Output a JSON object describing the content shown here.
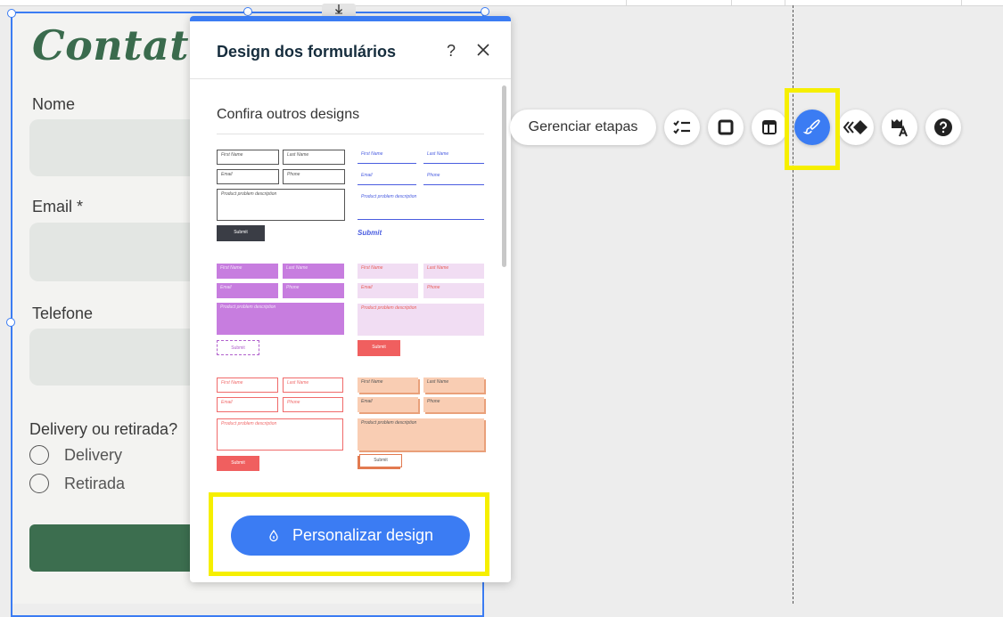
{
  "form": {
    "title": "Contate-",
    "fields": [
      {
        "label": "Nome"
      },
      {
        "label": "Email *"
      },
      {
        "label": "Telefone"
      }
    ],
    "radio_group": {
      "label": "Delivery ou retirada?",
      "options": [
        "Delivery",
        "Retirada"
      ]
    }
  },
  "panel": {
    "title": "Design dos formulários",
    "help_label": "?",
    "close_label": "✕",
    "section_title": "Confira outros designs",
    "primary_button": "Personalizar design"
  },
  "thumbnails": {
    "first_name": "First Name",
    "last_name": "Last Name",
    "email": "Email",
    "phone": "Phone",
    "description": "Product problem description",
    "submit": "Submit"
  },
  "toolbar": {
    "manage_steps": "Gerenciar etapas",
    "icons": [
      "checklist-icon",
      "square-icon",
      "layout-icon",
      "brush-icon",
      "animation-icon",
      "text-style-icon",
      "help-icon"
    ]
  },
  "colors": {
    "accent": "#3b7cf3",
    "form_green": "#3c6e4f",
    "highlight": "#f6ef00"
  }
}
